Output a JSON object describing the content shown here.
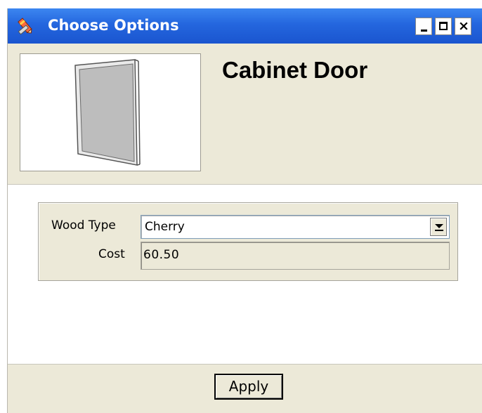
{
  "window": {
    "title": "Choose Options",
    "icon": "pencil-ruler-icon",
    "controls": {
      "minimize": "minimize-icon",
      "maximize": "maximize-icon",
      "close": "close-icon"
    }
  },
  "header": {
    "item_title": "Cabinet Door",
    "preview_image": "cabinet-door-preview"
  },
  "options": {
    "wood_type_label": "Wood Type",
    "wood_type_value": "Cherry",
    "cost_label": "Cost",
    "cost_value": "60.50"
  },
  "footer": {
    "apply_label": "Apply"
  },
  "colors": {
    "titlebar": "#2466de",
    "panel": "#ece9d8"
  }
}
